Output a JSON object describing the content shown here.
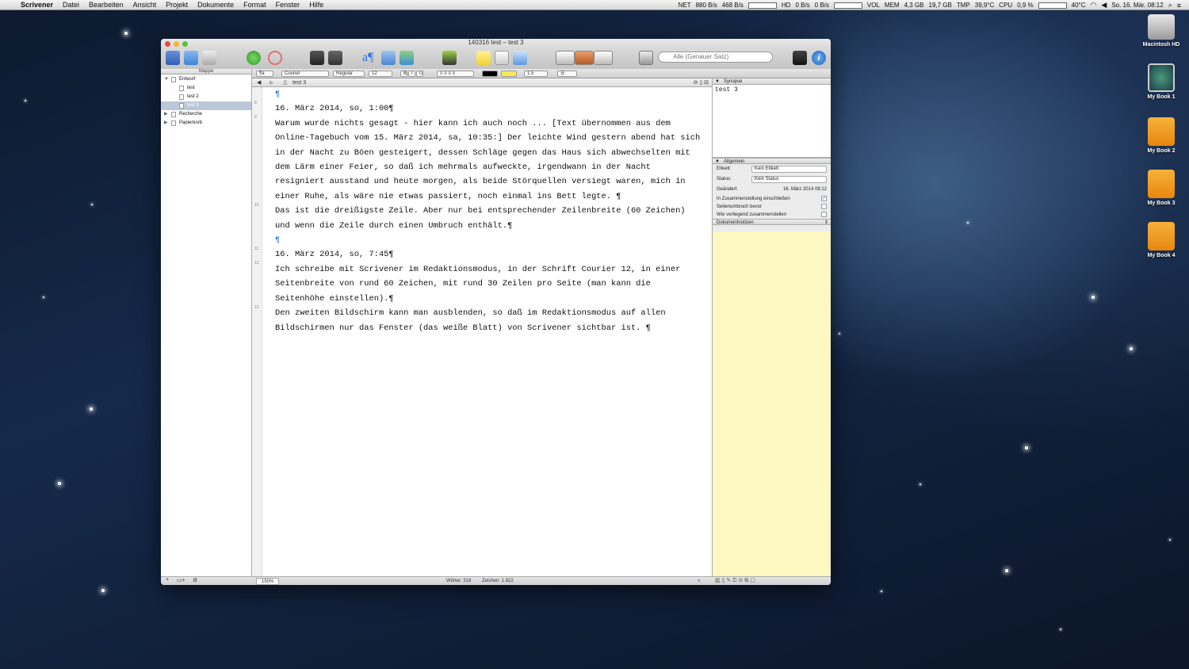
{
  "menubar": {
    "app": "Scrivener",
    "items": [
      "Datei",
      "Bearbeiten",
      "Ansicht",
      "Projekt",
      "Dokumente",
      "Format",
      "Fenster",
      "Hilfe"
    ],
    "stats": {
      "net": "NET",
      "net_up": "880 B/s",
      "net_down": "468 B/s",
      "hd": "HD",
      "hd_r": "0 B/s",
      "hd_w": "0 B/s",
      "vol": "VOL",
      "mem": "MEM",
      "mem_a": "4,3 GB",
      "mem_b": "19,7 GB",
      "tmp": "TMP",
      "tmp_val": "39,9°C",
      "cpu": "CPU",
      "cpu_val": "0,9 %",
      "fan": "40°C",
      "clock": "So. 16. Mär. 08:12"
    }
  },
  "window": {
    "title": "140316 test – test 3",
    "search_placeholder": "Alle (Genauer Satz)"
  },
  "format_bar": {
    "font": "Courier",
    "style": "Regular",
    "size": "12",
    "bold": "B",
    "italic": "I",
    "underline": "U",
    "spacing": "1.5"
  },
  "binder": {
    "header": "Mappe",
    "items": [
      {
        "label": "Entwurf",
        "level": 0
      },
      {
        "label": "test",
        "level": 1
      },
      {
        "label": "test 2",
        "level": 1
      },
      {
        "label": "test 3",
        "level": 1,
        "selected": true
      },
      {
        "label": "Recherche",
        "level": 0
      },
      {
        "label": "Papierkorb",
        "level": 0
      }
    ]
  },
  "editor": {
    "doc_title": "test 3",
    "line_numbers": [
      "8",
      "9",
      "10",
      "11",
      "12",
      "13"
    ],
    "paragraphs": [
      "¶",
      "16. März 2014, so, 1:00¶",
      "Warum wurde nichts gesagt - hier kann ich auch noch ... [Text übernommen aus dem Online-Tagebuch vom 15. März 2014, sa, 10:35:] Der leichte Wind gestern abend hat sich in der Nacht zu Böen gesteigert, dessen Schläge gegen das Haus sich abwechselten mit dem Lärm einer Feier, so daß ich mehrmals aufweckte, irgendwann in der Nacht resigniert ausstand und heute morgen, als beide Störquellen versiegt waren, mich in einer Ruhe, als wäre nie etwas passiert, noch einmal ins Bett legte. ¶",
      "Das ist die dreißigste Zeile. Aber nur bei entsprechender Zeilenbreite (60 Zeichen) und wenn die Zeile durch einen Umbruch enthält.¶",
      "¶",
      "16. März 2014, so, 7:45¶",
      "Ich schreibe mit Scrivener im Redaktionsmodus, in der Schrift Courier 12, in einer Seitenbreite von rund 60 Zeichen, mit rund 30 Zeilen pro Seite (man kann die Seitenhöhe einstellen).¶",
      "Den zweiten Bildschirm kann man ausblenden, so daß im Redaktionsmodus auf allen Bildschirmen nur das Fenster (das weiße Blatt) von Scrivener sichtbar ist. ¶"
    ],
    "zoom": "150%",
    "words": "Wörter: 318",
    "chars": "Zeichen: 1.922"
  },
  "inspector": {
    "synopsis_label": "Synopse",
    "synopsis_text": "test 3",
    "general_label": "Allgemein",
    "label_field": "Etikett:",
    "label_value": "Kein Etikett",
    "status_field": "Status:",
    "status_value": "Kein Status",
    "modified_field": "Geändert:",
    "modified_value": "16. März 2014 08:12",
    "include_compile": "In Zusammenstellung einschließen",
    "page_break": "Seitenumbruch bevor",
    "compile_as_is": "Wie vorliegend zusammenstellen",
    "notes_label": "Dokumentnotizen"
  },
  "desktop": {
    "icons": [
      "Macintosh HD",
      "My Book 1",
      "My Book 2",
      "My Book 3",
      "My Book 4"
    ]
  },
  "colors": {
    "accent": "#2a6fdc",
    "notes_bg": "#fdf7c2"
  }
}
